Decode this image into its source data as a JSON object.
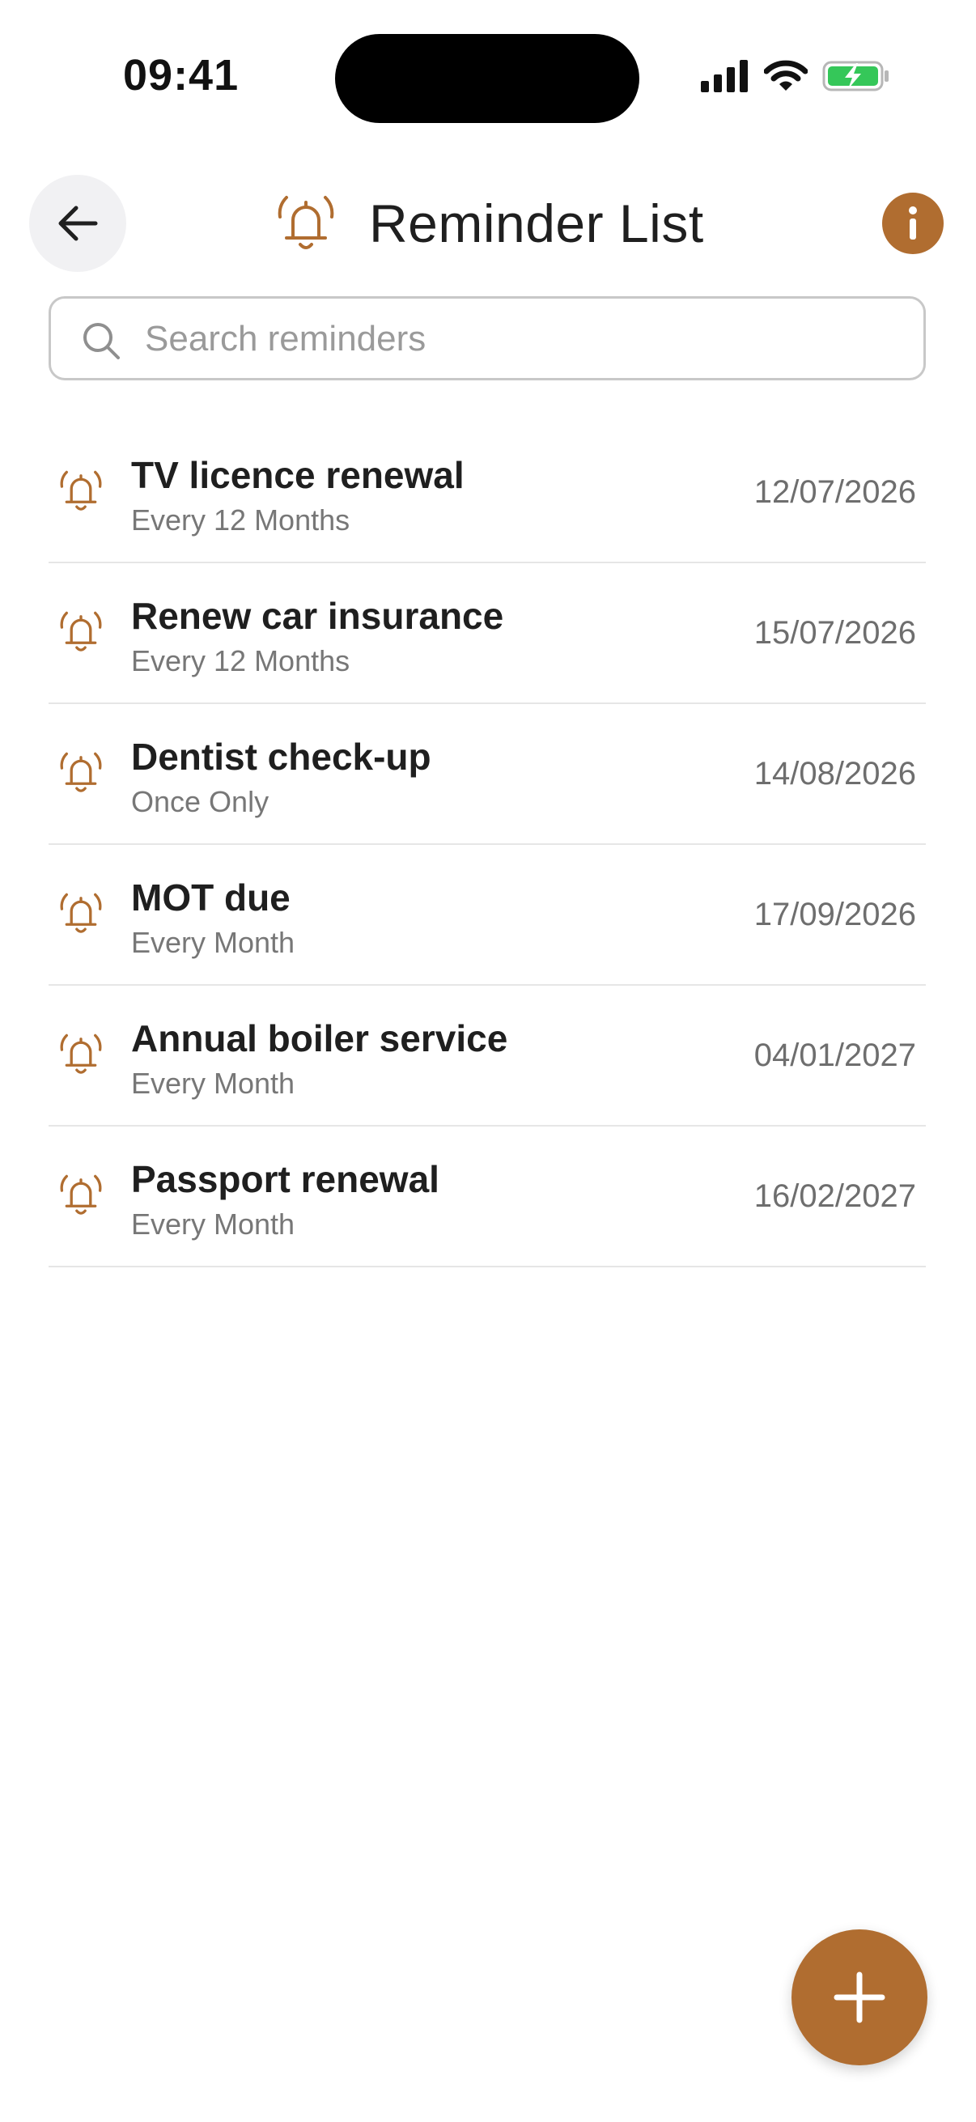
{
  "colors": {
    "accent": "#b06d30",
    "battery_green": "#35c759",
    "divider": "#e6e6e6"
  },
  "status_bar": {
    "time": "09:41",
    "icons": [
      "signal-icon",
      "wifi-icon",
      "battery-charging-icon"
    ]
  },
  "header": {
    "title": "Reminder List",
    "title_icon": "bell-ringing-icon",
    "back_icon": "arrow-left-icon",
    "info_icon": "info-icon"
  },
  "search": {
    "placeholder": "Search reminders",
    "value": ""
  },
  "reminders": [
    {
      "title": "TV licence renewal",
      "frequency": "Every 12 Months",
      "date": "12/07/2026"
    },
    {
      "title": "Renew car insurance",
      "frequency": "Every 12 Months",
      "date": "15/07/2026"
    },
    {
      "title": "Dentist check-up",
      "frequency": "Once Only",
      "date": "14/08/2026"
    },
    {
      "title": "MOT due",
      "frequency": "Every Month",
      "date": "17/09/2026"
    },
    {
      "title": "Annual boiler service",
      "frequency": "Every Month",
      "date": "04/01/2027"
    },
    {
      "title": "Passport renewal",
      "frequency": "Every Month",
      "date": "16/02/2027"
    }
  ],
  "fab": {
    "icon": "plus-icon"
  }
}
